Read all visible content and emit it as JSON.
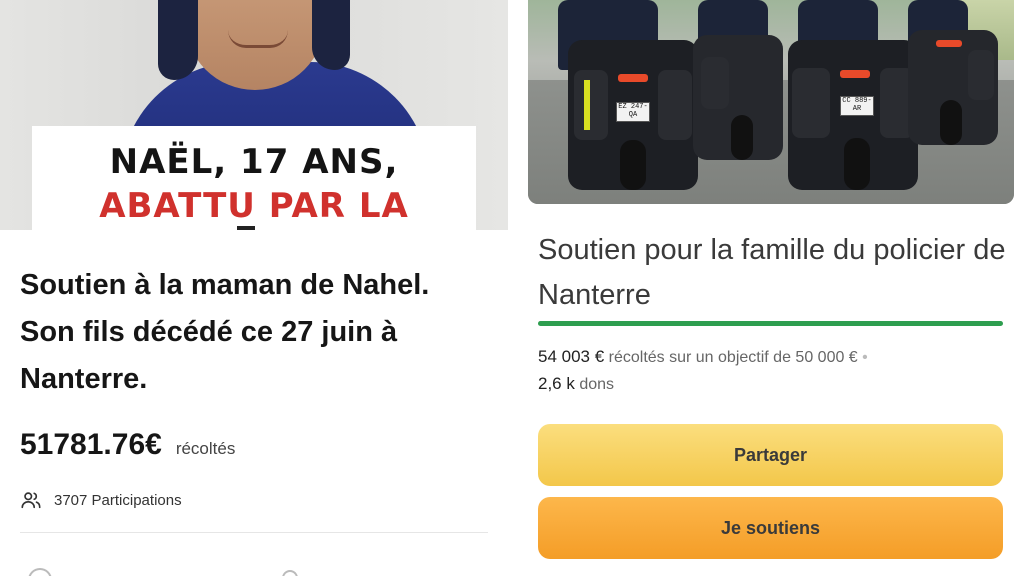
{
  "left_card": {
    "caption_line1": "NAËL, 17 ANS,",
    "caption_line2": "ABATTU PAR LA",
    "title": "Soutien à la maman de Nahel. Son fils décédé ce 27 juin à Nanterre.",
    "amount": "51781.76€",
    "amount_label": "récoltés",
    "participants": "3707 Participations",
    "icon": "people-icon"
  },
  "right_card": {
    "title": "Soutien pour la famille du policier de Nanterre",
    "progress_fraction": 1.0,
    "progress_color": "#2e9e4f",
    "stats": {
      "raised": "54 003 €",
      "raised_suffix": "récoltés sur un objectif de",
      "goal": "50 000 €",
      "separator": "•",
      "donations": "2,6 k",
      "donations_label": "dons"
    },
    "plates": [
      "EZ 247-QA",
      "CC 889-AR"
    ],
    "buttons": {
      "share": "Partager",
      "support": "Je soutiens"
    }
  },
  "colors": {
    "caption_red": "#d0312d",
    "share_button": "#f7d35f",
    "support_button": "#f7a935"
  }
}
